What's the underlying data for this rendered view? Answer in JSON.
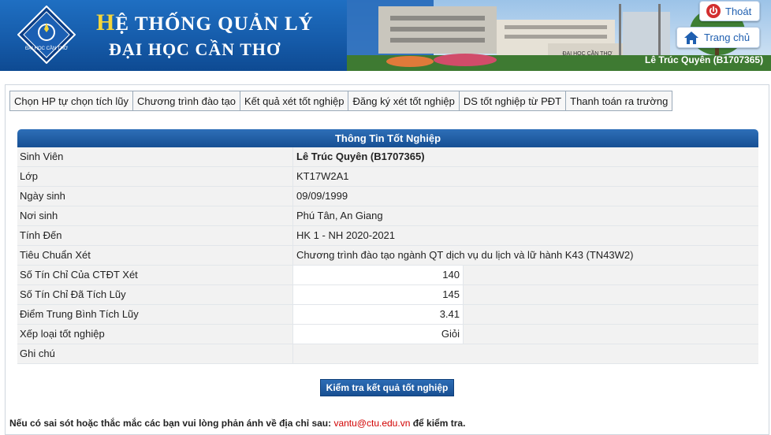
{
  "header": {
    "title_first_letter": "H",
    "title_rest": "Ệ THỐNG QUẢN LÝ",
    "subtitle": "ĐẠI HỌC CẦN THƠ",
    "logout_label": "Thoát",
    "home_label": "Trang chủ",
    "user": "Lê Trúc Quyên (B1707365)",
    "logo_text": "ĐẠI HỌC CẦN THƠ"
  },
  "tabs": [
    "Chọn HP tự chọn tích lũy",
    "Chương trình đào tạo",
    "Kết quả xét tốt nghiệp",
    "Đăng ký xét tốt nghiệp",
    "DS tốt nghiệp từ PĐT",
    "Thanh toán ra trường"
  ],
  "info": {
    "title": "Thông Tin Tốt Nghiệp",
    "rows": [
      {
        "label": "Sinh Viên",
        "value": "Lê Trúc Quyên (B1707365)"
      },
      {
        "label": "Lớp",
        "value": "KT17W2A1"
      },
      {
        "label": "Ngày sinh",
        "value": "09/09/1999"
      },
      {
        "label": "Nơi sinh",
        "value": "Phú Tân, An Giang"
      },
      {
        "label": "Tính Đến",
        "value": "HK 1 - NH 2020-2021"
      },
      {
        "label": "Tiêu Chuẩn Xét",
        "value": "Chương trình đào tạo ngành QT dịch vụ du lịch và lữ hành K43 (TN43W2)"
      },
      {
        "label": "Số Tín Chỉ Của CTĐT Xét",
        "value": "140"
      },
      {
        "label": "Số Tín Chỉ Đã Tích Lũy",
        "value": "145"
      },
      {
        "label": "Điểm Trung Bình Tích Lũy",
        "value": "3.41"
      },
      {
        "label": "Xếp loại tốt nghiệp",
        "value": "Giỏi"
      },
      {
        "label": "Ghi chú",
        "value": ""
      }
    ]
  },
  "check_button": "Kiểm tra kết quả tốt nghiệp",
  "note": {
    "before": "Nếu có sai sót hoặc thắc mắc các bạn vui lòng phản ánh về địa chỉ sau: ",
    "email": "vantu@ctu.edu.vn",
    "after": " để kiểm tra."
  },
  "colors": {
    "header_blue": "#155aa8",
    "accent_red": "#d10000",
    "title_yellow": "#f5d63a"
  }
}
